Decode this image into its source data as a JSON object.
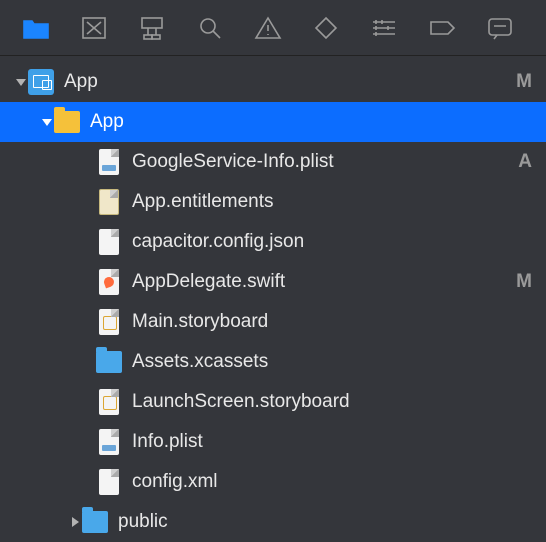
{
  "tree": {
    "project": {
      "label": "App",
      "status": "M"
    },
    "app_folder": {
      "label": "App"
    },
    "items": [
      {
        "label": "GoogleService-Info.plist",
        "status": "A",
        "icon": "plist"
      },
      {
        "label": "App.entitlements",
        "status": "",
        "icon": "entitle"
      },
      {
        "label": "capacitor.config.json",
        "status": "",
        "icon": "doc"
      },
      {
        "label": "AppDelegate.swift",
        "status": "M",
        "icon": "swift"
      },
      {
        "label": "Main.storyboard",
        "status": "",
        "icon": "storyboard"
      },
      {
        "label": "Assets.xcassets",
        "status": "",
        "icon": "folder-blue"
      },
      {
        "label": "LaunchScreen.storyboard",
        "status": "",
        "icon": "storyboard"
      },
      {
        "label": "Info.plist",
        "status": "",
        "icon": "plist"
      },
      {
        "label": "config.xml",
        "status": "",
        "icon": "doc"
      }
    ],
    "public_folder": {
      "label": "public"
    }
  }
}
